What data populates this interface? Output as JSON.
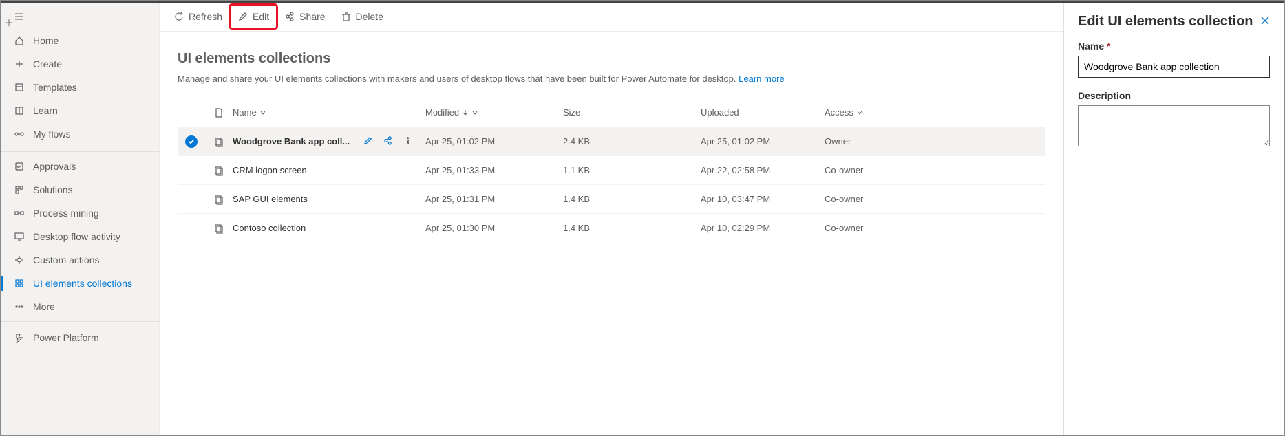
{
  "sidebar": {
    "top": [
      {
        "label": "Home",
        "icon": "home-icon"
      },
      {
        "label": "Create",
        "icon": "plus-icon"
      },
      {
        "label": "Templates",
        "icon": "templates-icon"
      },
      {
        "label": "Learn",
        "icon": "book-icon"
      },
      {
        "label": "My flows",
        "icon": "flow-icon"
      }
    ],
    "mid": [
      {
        "label": "Approvals",
        "icon": "approvals-icon"
      },
      {
        "label": "Solutions",
        "icon": "solutions-icon"
      },
      {
        "label": "Process mining",
        "icon": "process-mining-icon"
      },
      {
        "label": "Desktop flow activity",
        "icon": "desktop-activity-icon"
      },
      {
        "label": "Custom actions",
        "icon": "custom-actions-icon"
      },
      {
        "label": "UI elements collections",
        "icon": "ui-elements-icon",
        "active": true
      },
      {
        "label": "More",
        "icon": "more-icon"
      }
    ],
    "btm": [
      {
        "label": "Power Platform",
        "icon": "power-platform-icon"
      }
    ]
  },
  "toolbar": {
    "refresh": "Refresh",
    "edit": "Edit",
    "share": "Share",
    "delete": "Delete"
  },
  "page": {
    "title": "UI elements collections",
    "description": "Manage and share your UI elements collections with makers and users of desktop flows that have been built for Power Automate for desktop.",
    "learn_more": "Learn more"
  },
  "table": {
    "headers": {
      "name": "Name",
      "modified": "Modified",
      "size": "Size",
      "uploaded": "Uploaded",
      "access": "Access"
    },
    "rows": [
      {
        "selected": true,
        "name": "Woodgrove Bank app coll...",
        "modified": "Apr 25, 01:02 PM",
        "size": "2.4 KB",
        "uploaded": "Apr 25, 01:02 PM",
        "access": "Owner"
      },
      {
        "selected": false,
        "name": "CRM logon screen",
        "modified": "Apr 25, 01:33 PM",
        "size": "1.1 KB",
        "uploaded": "Apr 22, 02:58 PM",
        "access": "Co-owner"
      },
      {
        "selected": false,
        "name": "SAP GUI elements",
        "modified": "Apr 25, 01:31 PM",
        "size": "1.4 KB",
        "uploaded": "Apr 10, 03:47 PM",
        "access": "Co-owner"
      },
      {
        "selected": false,
        "name": "Contoso collection",
        "modified": "Apr 25, 01:30 PM",
        "size": "1.4 KB",
        "uploaded": "Apr 10, 02:29 PM",
        "access": "Co-owner"
      }
    ]
  },
  "panel": {
    "title": "Edit UI elements collection",
    "name_label": "Name",
    "name_value": "Woodgrove Bank app collection",
    "description_label": "Description",
    "description_value": ""
  }
}
